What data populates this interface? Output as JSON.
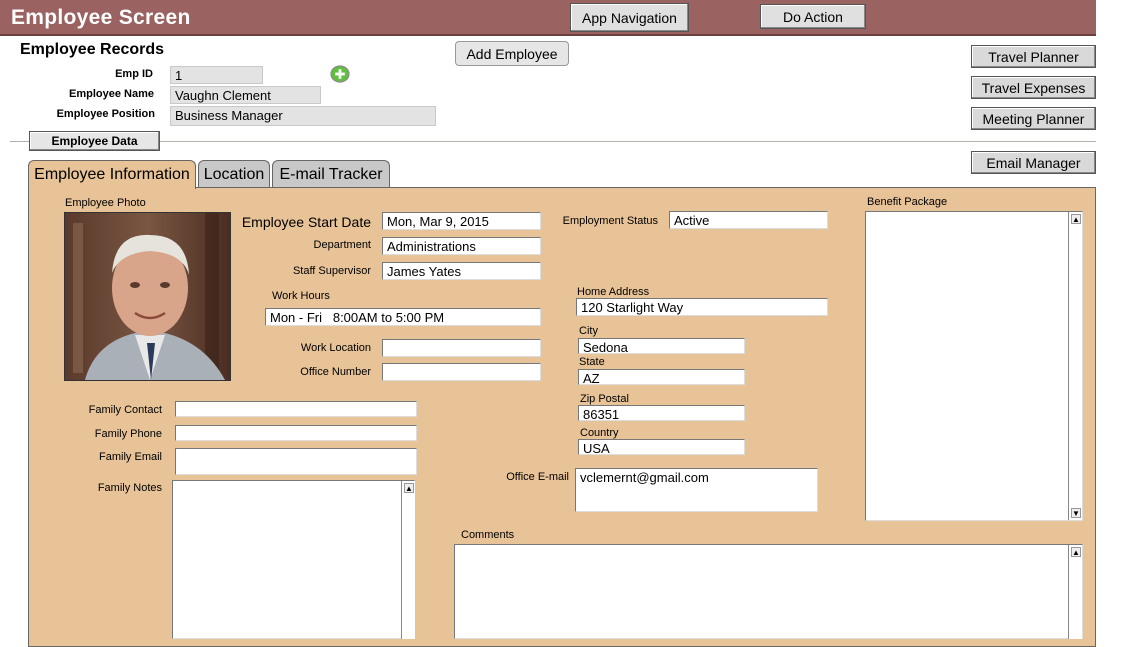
{
  "header": {
    "title": "Employee Screen",
    "app_nav_label": "App Navigation",
    "do_action_label": "Do Action"
  },
  "records": {
    "title": "Employee Records",
    "add_employee_label": "Add Employee",
    "emp_id_label": "Emp ID",
    "emp_id_value": "1",
    "name_label": "Employee Name",
    "name_value": "Vaughn Clement",
    "position_label": "Employee Position",
    "position_value": "Business Manager"
  },
  "side_buttons": {
    "travel_planner": "Travel Planner",
    "travel_expenses": "Travel Expenses",
    "meeting_planner": "Meeting Planner",
    "email_manager": "Email Manager"
  },
  "section_label": "Employee Data",
  "tabs": [
    {
      "label": "Employee Information",
      "active": true
    },
    {
      "label": "Location",
      "active": false
    },
    {
      "label": "E-mail Tracker",
      "active": false
    }
  ],
  "info": {
    "photo_label": "Employee Photo",
    "start_date_label": "Employee Start Date",
    "start_date_value": "Mon, Mar 9, 2015",
    "department_label": "Department",
    "department_value": "Administrations",
    "supervisor_label": "Staff Supervisor",
    "supervisor_value": "James Yates",
    "work_hours_label": "Work Hours",
    "work_hours_value": "Mon - Fri   8:00AM to 5:00 PM",
    "work_location_label": "Work Location",
    "work_location_value": "",
    "office_number_label": "Office Number",
    "office_number_value": "",
    "employment_status_label": "Employment Status",
    "employment_status_value": "Active",
    "home_address_label": "Home Address",
    "home_address_value": "120 Starlight Way",
    "city_label": "City",
    "city_value": "Sedona",
    "state_label": "State",
    "state_value": "AZ",
    "zip_label": "Zip Postal",
    "zip_value": "86351",
    "country_label": "Country",
    "country_value": "USA",
    "office_email_label": "Office E-mail",
    "office_email_value": "vclemernt@gmail.com",
    "family_contact_label": "Family Contact",
    "family_contact_value": "",
    "family_phone_label": "Family Phone",
    "family_phone_value": "",
    "family_email_label": "Family Email",
    "family_email_value": "",
    "family_notes_label": "Family Notes",
    "family_notes_value": "",
    "benefit_label": "Benefit Package",
    "benefit_value": "",
    "comments_label": "Comments",
    "comments_value": ""
  },
  "colors": {
    "header": "#9b6262",
    "panel": "#e8c397",
    "add_icon": "#5fbf3f"
  },
  "icons": {
    "add_record": "plus-circle-icon",
    "scroll_up": "arrow-up-icon",
    "scroll_down": "arrow-down-icon",
    "photo": "employee-photo"
  }
}
